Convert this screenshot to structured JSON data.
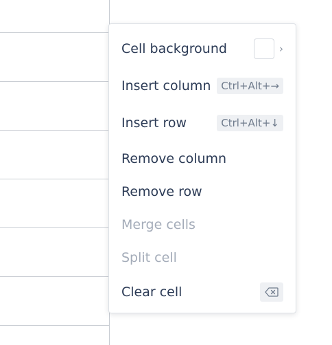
{
  "menu": {
    "items": [
      {
        "label": "Cell background",
        "disabled": false,
        "shortcut": null,
        "icon": "color-swatch"
      },
      {
        "label": "Insert column",
        "disabled": false,
        "shortcut": "Ctrl+Alt+→"
      },
      {
        "label": "Insert row",
        "disabled": false,
        "shortcut": "Ctrl+Alt+↓"
      },
      {
        "label": "Remove column",
        "disabled": false,
        "shortcut": null
      },
      {
        "label": "Remove row",
        "disabled": false,
        "shortcut": null
      },
      {
        "label": "Merge cells",
        "disabled": true,
        "shortcut": null
      },
      {
        "label": "Split cell",
        "disabled": true,
        "shortcut": null
      },
      {
        "label": "Clear cell",
        "disabled": false,
        "shortcut": null,
        "icon": "backspace-icon"
      }
    ],
    "swatch_color": "#ffffff",
    "chevron": "›"
  },
  "colors": {
    "text": "#2b3a55",
    "disabled_text": "#a4acb9",
    "shortcut_bg": "#eef0f3",
    "border": "#dde1e6",
    "grid": "#c9cdd3"
  }
}
